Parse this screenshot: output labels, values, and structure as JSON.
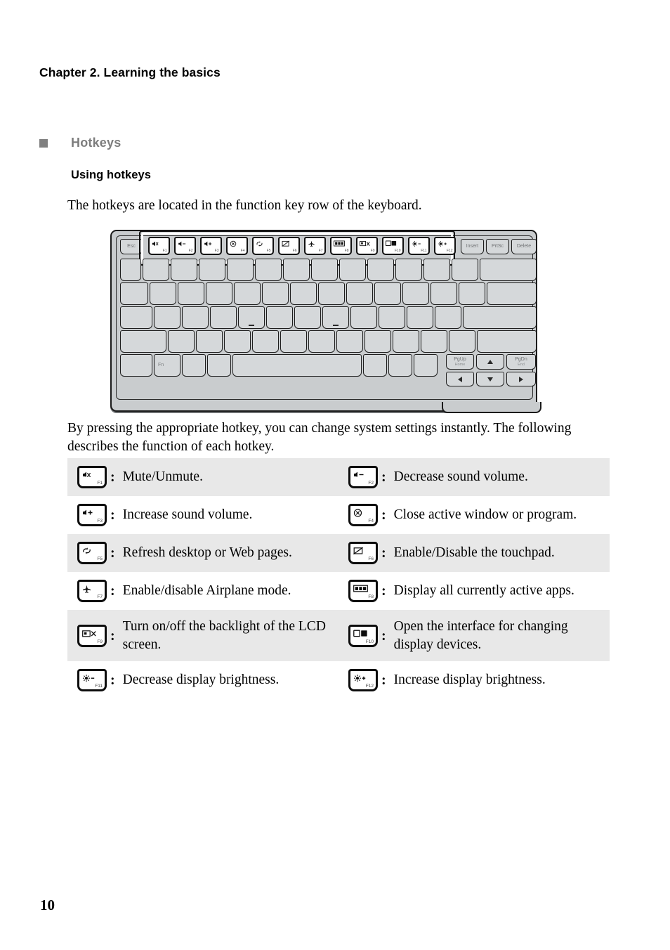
{
  "document": {
    "chapter_title": "Chapter 2. Learning the basics",
    "section_title": "Hotkeys",
    "subsection_title": "Using hotkeys",
    "intro_text": "The hotkeys are located in the function key row of the keyboard.",
    "body_text": "By pressing the appropriate hotkey, you can change system settings instantly. The following describes the function of each hotkey.",
    "page_number": "10"
  },
  "keyboard": {
    "esc_label": "Esc",
    "fn_label": "Fn",
    "top_right_keys": [
      "Insert",
      "PrtSc",
      "Delete"
    ],
    "nav_keys": [
      {
        "main": "PgUp",
        "sub": "Home"
      },
      {
        "main": "PgDn",
        "sub": "End"
      }
    ],
    "arrow_keys": [
      "up-arrow",
      "left-arrow",
      "down-arrow",
      "right-arrow"
    ],
    "function_keys": [
      {
        "num": "F1",
        "glyph": "⍇",
        "icon": "mute-icon"
      },
      {
        "num": "F2",
        "glyph": "\u0001",
        "icon": "volume-down-icon"
      },
      {
        "num": "F3",
        "glyph": "\u0001",
        "icon": "volume-up-icon"
      },
      {
        "num": "F4",
        "glyph": "⊗",
        "icon": "close-window-icon"
      },
      {
        "num": "F5",
        "glyph": "\u0001",
        "icon": "refresh-icon"
      },
      {
        "num": "F6",
        "glyph": "\u0001",
        "icon": "touchpad-toggle-icon"
      },
      {
        "num": "F7",
        "glyph": "✈",
        "icon": "airplane-mode-icon"
      },
      {
        "num": "F8",
        "glyph": "\u0001",
        "icon": "active-apps-icon"
      },
      {
        "num": "F9",
        "glyph": "\u0001",
        "icon": "lcd-backlight-icon"
      },
      {
        "num": "F10",
        "glyph": "\u0001",
        "icon": "display-devices-icon"
      },
      {
        "num": "F11",
        "glyph": "\u0001",
        "icon": "brightness-down-icon"
      },
      {
        "num": "F12",
        "glyph": "\u0001",
        "icon": "brightness-up-icon"
      }
    ]
  },
  "hotkey_table": {
    "rows": [
      {
        "shaded": true,
        "left": {
          "key": "F1",
          "icon": "mute-icon",
          "description": "Mute/Unmute."
        },
        "right": {
          "key": "F2",
          "icon": "volume-down-icon",
          "description": "Decrease sound volume."
        }
      },
      {
        "shaded": false,
        "left": {
          "key": "F3",
          "icon": "volume-up-icon",
          "description": "Increase sound volume."
        },
        "right": {
          "key": "F4",
          "icon": "close-window-icon",
          "description": "Close active window or program."
        }
      },
      {
        "shaded": true,
        "left": {
          "key": "F5",
          "icon": "refresh-icon",
          "description": "Refresh desktop or Web pages."
        },
        "right": {
          "key": "F6",
          "icon": "touchpad-toggle-icon",
          "description": "Enable/Disable the touchpad."
        }
      },
      {
        "shaded": false,
        "left": {
          "key": "F7",
          "icon": "airplane-mode-icon",
          "description": "Enable/disable Airplane mode."
        },
        "right": {
          "key": "F8",
          "icon": "active-apps-icon",
          "description": "Display all currently active apps."
        }
      },
      {
        "shaded": true,
        "left": {
          "key": "F9",
          "icon": "lcd-backlight-icon",
          "description": "Turn on/off the backlight of the LCD screen."
        },
        "right": {
          "key": "F10",
          "icon": "display-devices-icon",
          "description": "Open the interface for changing display devices."
        }
      },
      {
        "shaded": false,
        "left": {
          "key": "F11",
          "icon": "brightness-down-icon",
          "description": "Decrease display brightness."
        },
        "right": {
          "key": "F12",
          "icon": "brightness-up-icon",
          "description": "Increase display brightness."
        }
      }
    ],
    "separator": ":"
  },
  "colors": {
    "shaded_row": "#e8e8e8",
    "section_heading": "#7d7d7d",
    "keyboard_body": "#c9ccce",
    "keycap": "#d5d8da",
    "text": "#000000"
  }
}
